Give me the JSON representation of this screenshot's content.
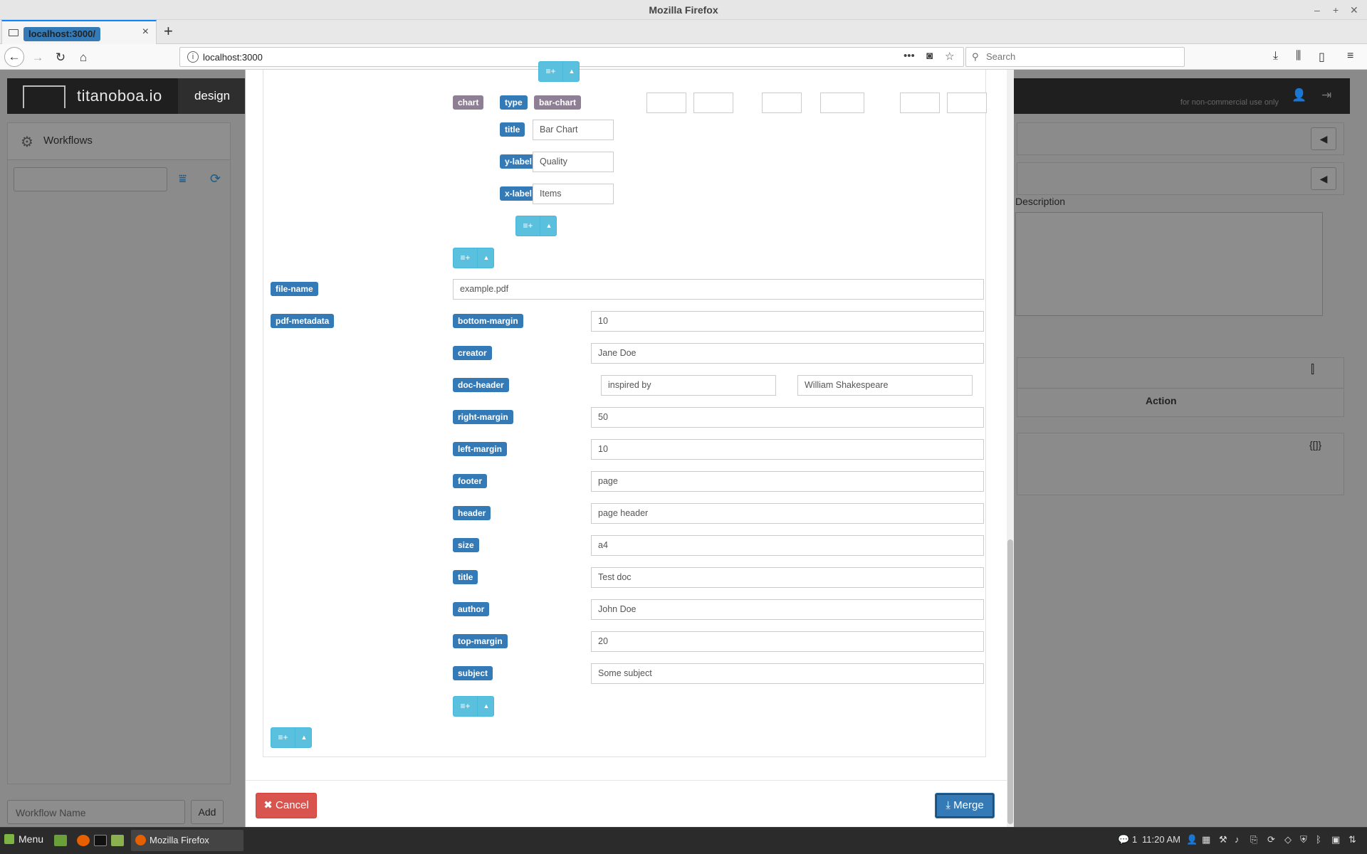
{
  "window": {
    "title": "Mozilla Firefox"
  },
  "browser": {
    "tab_title": "localhost:3000/",
    "url": "localhost:3000",
    "search_placeholder": "Search"
  },
  "app": {
    "brand": "titanoboa.io",
    "nav_design": "design",
    "license_note": "for non-commercial use only",
    "left_panel_title": "Workflows",
    "workflow_name_placeholder": "Workflow Name",
    "add_label": "Add",
    "description_label": "Description",
    "action_header": "Action"
  },
  "chart": {
    "key": "chart",
    "type_key": "type",
    "type_value": "bar-chart",
    "title_key": "title",
    "title_value": "Bar Chart",
    "ylabel_key": "y-label",
    "ylabel_value": "Quality",
    "xlabel_key": "x-label",
    "xlabel_value": "Items"
  },
  "file": {
    "key": "file-name",
    "value": "example.pdf"
  },
  "pdf_metadata": {
    "key": "pdf-metadata",
    "rows": [
      {
        "key": "bottom-margin",
        "value": "10"
      },
      {
        "key": "creator",
        "value": "Jane Doe"
      },
      {
        "key": "doc-header",
        "value": "inspired by",
        "value2": "William Shakespeare"
      },
      {
        "key": "right-margin",
        "value": "50"
      },
      {
        "key": "left-margin",
        "value": "10"
      },
      {
        "key": "footer",
        "value": "page"
      },
      {
        "key": "header",
        "value": "page header"
      },
      {
        "key": "size",
        "value": "a4"
      },
      {
        "key": "title",
        "value": "Test doc"
      },
      {
        "key": "author",
        "value": "John Doe"
      },
      {
        "key": "top-margin",
        "value": "20"
      },
      {
        "key": "subject",
        "value": "Some subject"
      }
    ]
  },
  "footer": {
    "cancel_label": "Cancel",
    "merge_label": "Merge"
  },
  "taskbar": {
    "menu_label": "Menu",
    "window_label": "Mozilla Firefox",
    "workspace": "1",
    "time": "11:20 AM"
  },
  "colors": {
    "label_blue": "#337ab7",
    "label_gray": "#8e7f94",
    "add_button": "#5bc0de",
    "cancel": "#d9534f",
    "merge": "#337ab7"
  }
}
